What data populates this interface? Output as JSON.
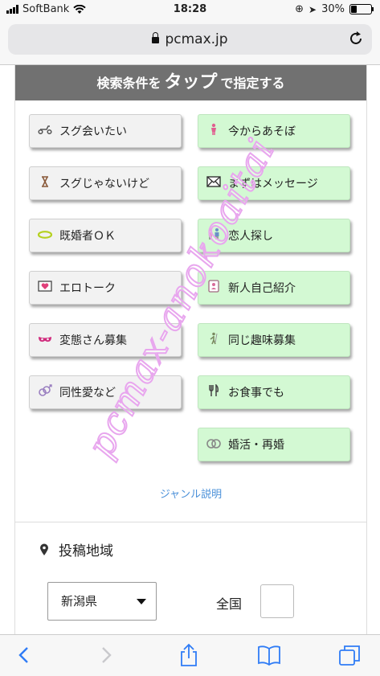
{
  "status_bar": {
    "carrier": "SoftBank",
    "time": "18:28",
    "battery": "30%",
    "battery_level": 0.3
  },
  "browser": {
    "url": "pcmax.jp"
  },
  "search": {
    "header_pre": "検索条件を",
    "header_big": "タップ",
    "header_post": "で指定する",
    "left_buttons": [
      {
        "label": "スグ会いたい",
        "icon": "scooter-icon"
      },
      {
        "label": "スグじゃないけど",
        "icon": "hourglass-icon"
      },
      {
        "label": "既婚者ＯＫ",
        "icon": "ring-icon"
      },
      {
        "label": "エロトーク",
        "icon": "heart-envelope-icon"
      },
      {
        "label": "変態さん募集",
        "icon": "mask-icon"
      },
      {
        "label": "同性愛など",
        "icon": "gender-icon"
      }
    ],
    "right_buttons": [
      {
        "label": "今からあそぼ",
        "icon": "person-icon"
      },
      {
        "label": "まずはメッセージ",
        "icon": "envelope-icon"
      },
      {
        "label": "恋人探し",
        "icon": "couple-icon"
      },
      {
        "label": "新人自己紹介",
        "icon": "badge-icon"
      },
      {
        "label": "同じ趣味募集",
        "icon": "golfer-icon"
      },
      {
        "label": "お食事でも",
        "icon": "fork-knife-icon"
      },
      {
        "label": "婚活・再婚",
        "icon": "rings-icon"
      }
    ],
    "genre_link": "ジャンル説明"
  },
  "area": {
    "title": "投稿地域",
    "prefecture": "新潟県",
    "nationwide_label": "全国",
    "nationwide_checked": false
  },
  "watermark": "pcmax-anokoaitai"
}
